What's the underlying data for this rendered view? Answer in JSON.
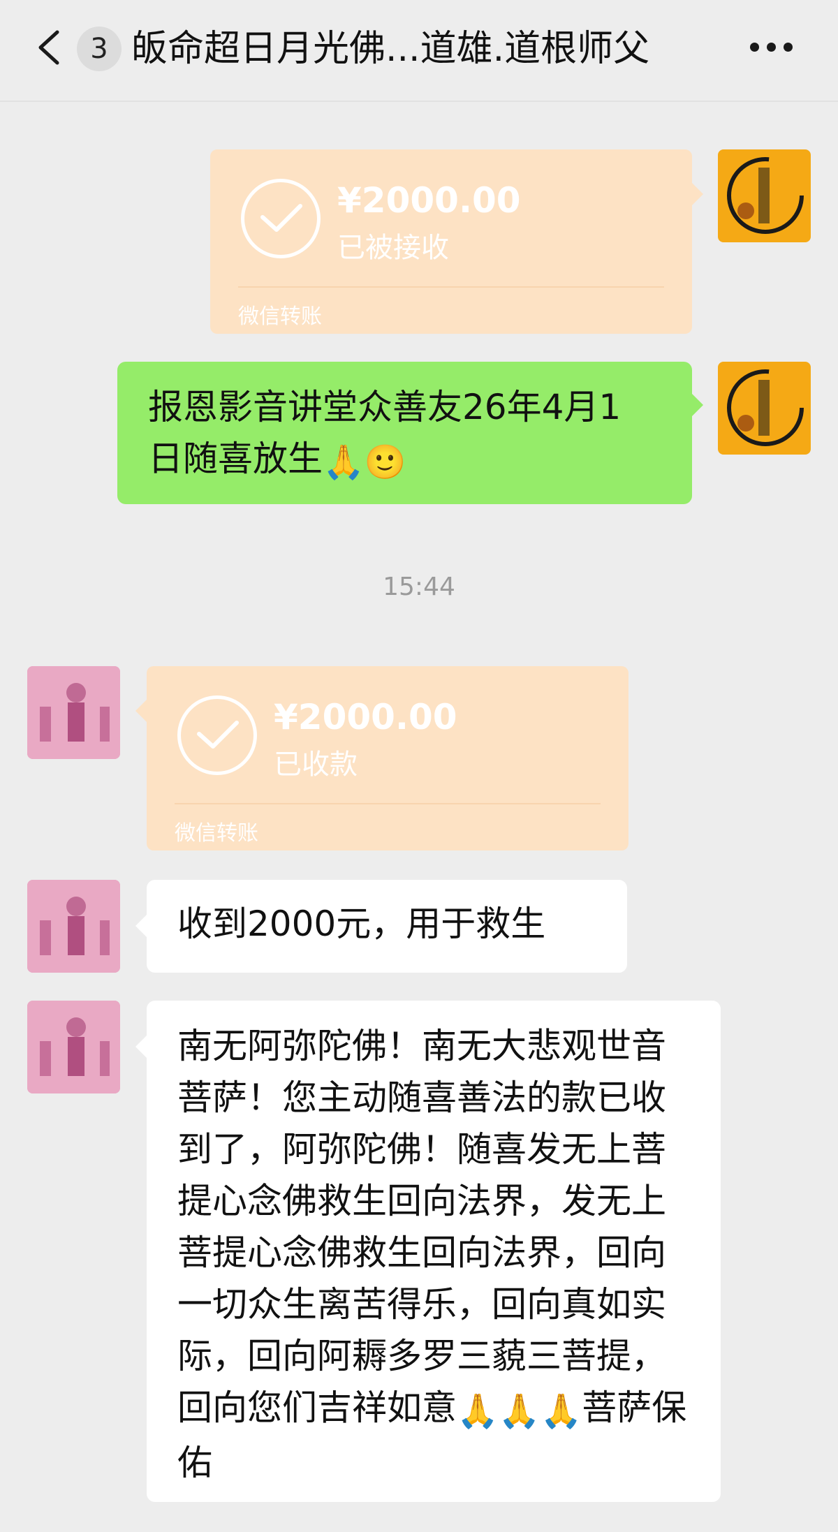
{
  "header": {
    "unread_count": "3",
    "title": "皈命超日月光佛...道雄.道根师父"
  },
  "icons": {
    "back": "chevron-left-icon",
    "more": "more-dots-icon",
    "transfer_check": "check-circle-icon"
  },
  "colors": {
    "background": "#ededed",
    "self_bubble": "#95ec69",
    "other_bubble": "#ffffff",
    "transfer_card": "#fde2c4"
  },
  "messages": {
    "m1": {
      "sender": "self",
      "type": "transfer",
      "amount": "¥2000.00",
      "status": "已被接收",
      "label": "微信转账"
    },
    "m2": {
      "sender": "self",
      "type": "text",
      "text": "报恩影音讲堂众善友26年4月1日随喜放生",
      "emojis": "🙏🙂"
    },
    "timestamp": "15:44",
    "m3": {
      "sender": "other",
      "type": "transfer",
      "amount": "¥2000.00",
      "status": "已收款",
      "label": "微信转账"
    },
    "m4": {
      "sender": "other",
      "type": "text",
      "text": "收到2000元，用于救生"
    },
    "m5": {
      "sender": "other",
      "type": "text",
      "text": "南无阿弥陀佛！南无大悲观世音菩萨！您主动随喜善法的款已收到了，阿弥陀佛！随喜发无上菩提心念佛救生回向法界，发无上菩提心念佛救生回向法界，回向一切众生离苦得乐，回向真如实际，回向阿耨多罗三藐三菩提，回向您们吉祥如意",
      "emojis": "🙏🙏🙏",
      "tail_text": "菩萨保佑"
    }
  }
}
